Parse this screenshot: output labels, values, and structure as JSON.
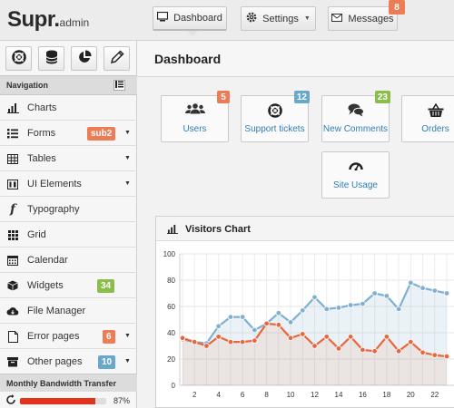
{
  "brand": {
    "name": "Supr.",
    "suffix": "admin"
  },
  "header": {
    "dashboard_label": "Dashboard",
    "settings_label": "Settings",
    "messages_label": "Messages",
    "messages_count": "8"
  },
  "sidebar": {
    "quick_buttons": [
      "support-icon",
      "database-icon",
      "pie-chart-icon",
      "pencil-icon"
    ],
    "nav_title": "Navigation",
    "items": [
      {
        "label": "Charts",
        "icon": "bar-chart-icon"
      },
      {
        "label": "Forms",
        "icon": "list-icon",
        "badge": "sub2",
        "badge_color": "#ec7c55",
        "has_submenu": true
      },
      {
        "label": "Tables",
        "icon": "table-icon",
        "has_submenu": true
      },
      {
        "label": "UI Elements",
        "icon": "ui-icon",
        "has_submenu": true
      },
      {
        "label": "Typography",
        "icon": "font-icon"
      },
      {
        "label": "Grid",
        "icon": "grid-icon"
      },
      {
        "label": "Calendar",
        "icon": "calendar-icon"
      },
      {
        "label": "Widgets",
        "icon": "cube-icon",
        "badge": "34",
        "badge_color": "#8bbd4b"
      },
      {
        "label": "File Manager",
        "icon": "cloud-icon"
      },
      {
        "label": "Error pages",
        "icon": "file-icon",
        "badge": "6",
        "badge_color": "#ec7c55",
        "has_submenu": true
      },
      {
        "label": "Other pages",
        "icon": "archive-icon",
        "badge": "10",
        "badge_color": "#6aa8c9",
        "has_submenu": true
      }
    ],
    "bandwidth_title": "Monthly Bandwidth Transfer",
    "bandwidth_value": 87,
    "bandwidth_label": "87%"
  },
  "main": {
    "page_title": "Dashboard",
    "stats": [
      {
        "label": "Users",
        "icon": "users-icon",
        "badge": "5",
        "badge_color": "#ec7c55"
      },
      {
        "label": "Support tickets",
        "icon": "support-icon",
        "badge": "12",
        "badge_color": "#6aa8c9"
      },
      {
        "label": "New Comments",
        "icon": "comments-icon",
        "badge": "23",
        "badge_color": "#8bbd4b"
      },
      {
        "label": "Orders",
        "icon": "basket-icon"
      },
      {
        "label": "Site Usage",
        "icon": "speedometer-icon"
      }
    ],
    "chart_title": "Visitors Chart"
  },
  "chart_data": {
    "type": "line",
    "title": "Visitors Chart",
    "ylim": [
      0,
      100
    ],
    "yticks": [
      "0",
      "20",
      "40",
      "60",
      "80",
      "100"
    ],
    "xticks": [
      "2",
      "4",
      "6",
      "8",
      "10",
      "12",
      "14",
      "16",
      "18",
      "20",
      "22"
    ],
    "grid": true,
    "x": [
      1,
      2,
      3,
      4,
      5,
      6,
      7,
      8,
      9,
      10,
      11,
      12,
      13,
      14,
      15,
      16,
      17,
      18,
      19,
      20,
      21,
      22,
      23
    ],
    "series": [
      {
        "color": "#7fb0cf",
        "values": [
          35,
          33,
          32,
          45,
          52,
          52,
          42,
          47,
          55,
          48,
          57,
          67,
          58,
          59,
          61,
          62,
          70,
          68,
          58,
          78,
          74,
          72,
          70
        ]
      },
      {
        "color": "#e8673e",
        "values": [
          36,
          33,
          30,
          37,
          33,
          33,
          34,
          47,
          46,
          36,
          39,
          30,
          37,
          28,
          37,
          27,
          26,
          37,
          26,
          33,
          25,
          23,
          22
        ]
      }
    ]
  }
}
